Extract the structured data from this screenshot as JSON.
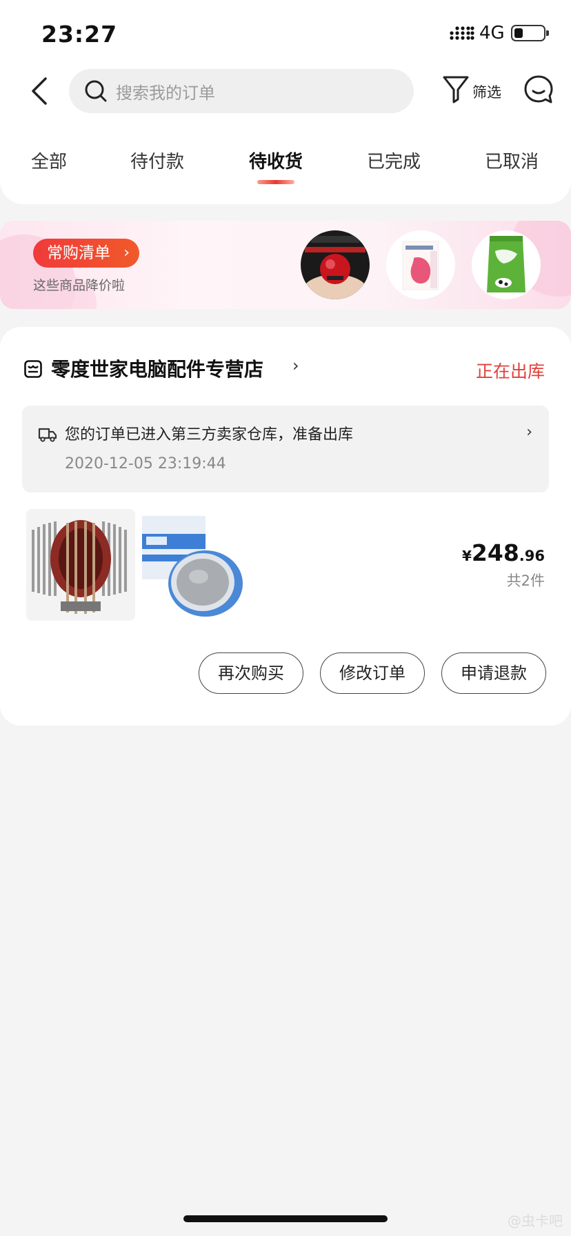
{
  "status_bar": {
    "time": "23:27",
    "network": "4G"
  },
  "nav": {
    "search_placeholder": "搜索我的订单",
    "filter_label": "筛选"
  },
  "tabs": [
    {
      "label": "全部"
    },
    {
      "label": "待付款"
    },
    {
      "label": "待收货",
      "active": true
    },
    {
      "label": "已完成"
    },
    {
      "label": "已取消"
    }
  ],
  "banner": {
    "title": "常购清单",
    "subtitle": "这些商品降价啦"
  },
  "order": {
    "shop_name": "零度世家电脑配件专营店",
    "status": "正在出库",
    "logistics_text": "您的订单已进入第三方卖家仓库，准备出库",
    "logistics_time": "2020-12-05 23:19:44",
    "price_currency": "¥",
    "price_int": "248",
    "price_dec": ".96",
    "quantity": "共2件",
    "actions": [
      "再次购买",
      "修改订单",
      "申请退款"
    ]
  },
  "watermark": "@虫卡吧",
  "colors": {
    "accent": "#e0403a",
    "banner_pill": "#f03a3a"
  }
}
